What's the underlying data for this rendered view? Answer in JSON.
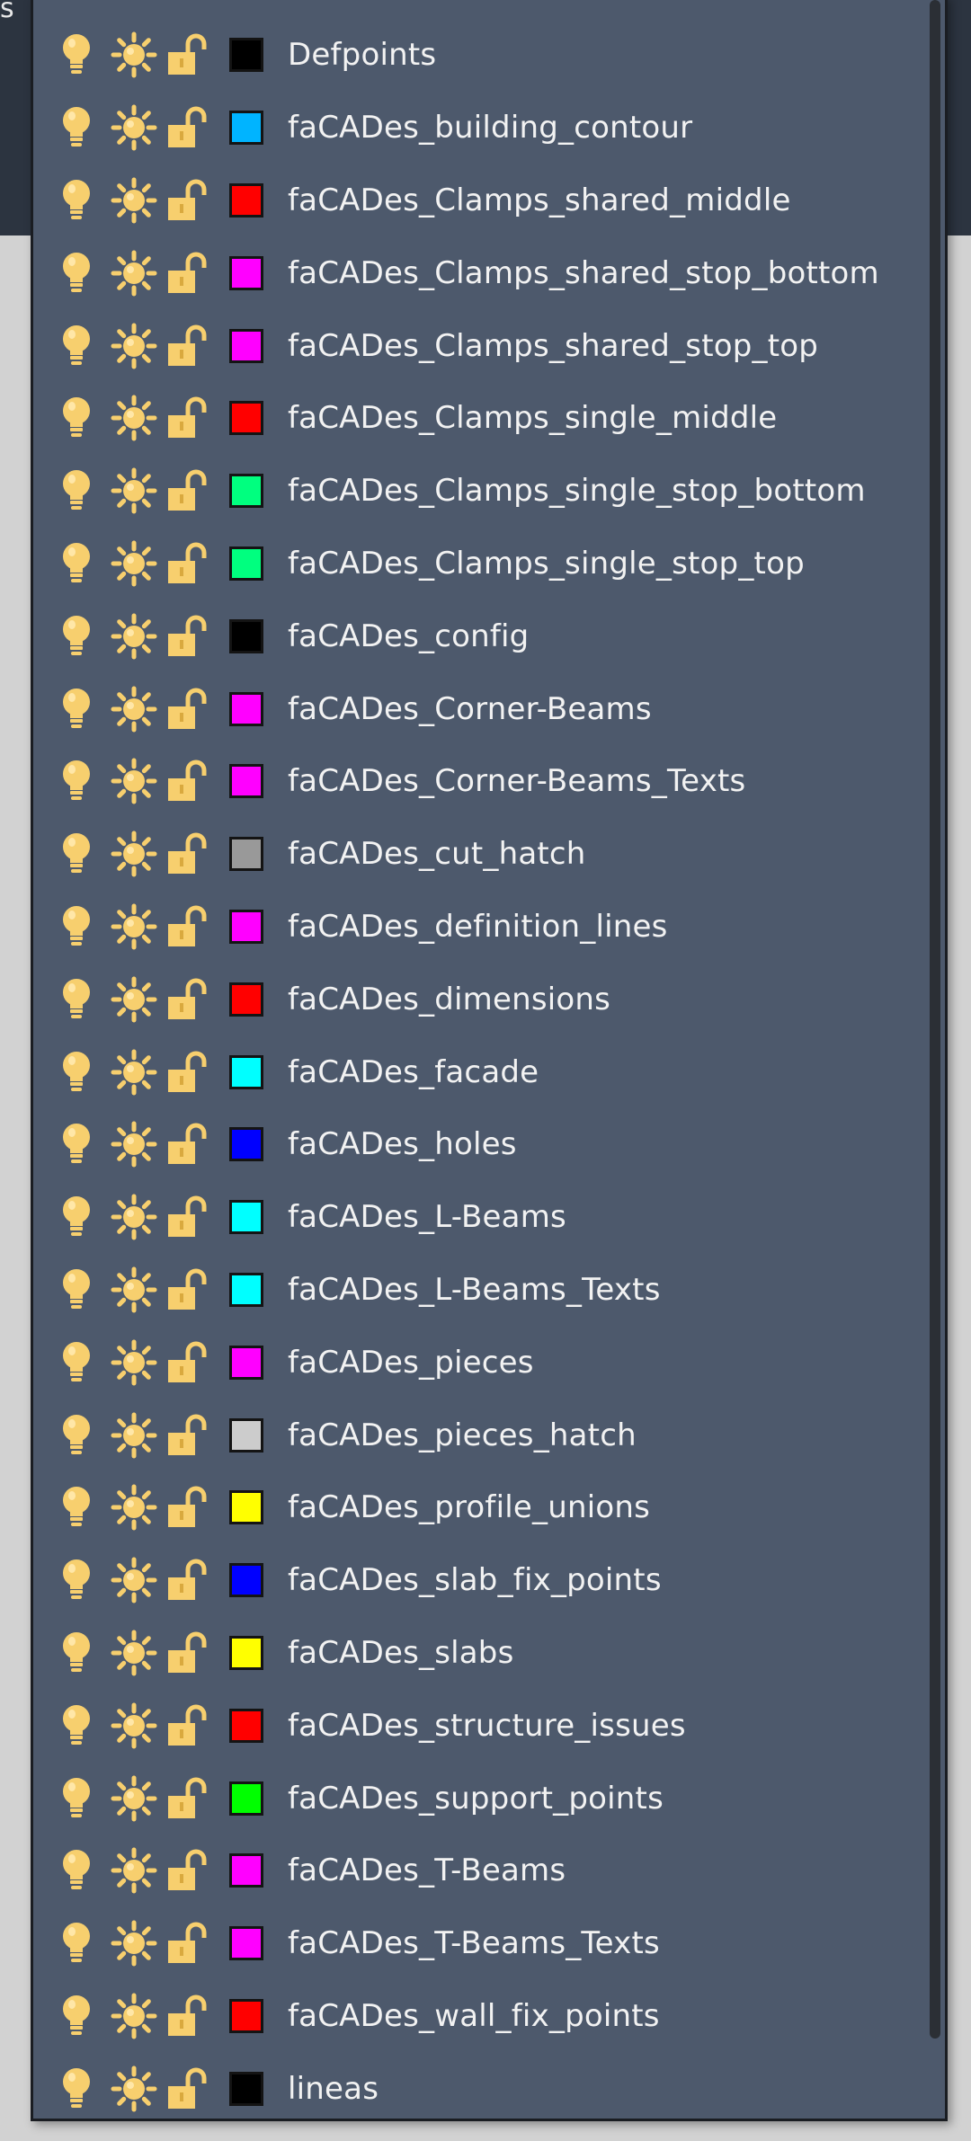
{
  "background": {
    "top_left_text": "s"
  },
  "colors": {
    "panel_bg": "#4d596c",
    "text": "#f2f2f2",
    "icon_yellow": "#f7cf6e",
    "page_bg": "#d2d2d2"
  },
  "layers": [
    {
      "name": "Defpoints",
      "color": "#000000"
    },
    {
      "name": "faCADes_building_contour",
      "color": "#00b4ff"
    },
    {
      "name": "faCADes_Clamps_shared_middle",
      "color": "#ff0000"
    },
    {
      "name": "faCADes_Clamps_shared_stop_bottom",
      "color": "#ff00ff"
    },
    {
      "name": "faCADes_Clamps_shared_stop_top",
      "color": "#ff00ff"
    },
    {
      "name": "faCADes_Clamps_single_middle",
      "color": "#ff0000"
    },
    {
      "name": "faCADes_Clamps_single_stop_bottom",
      "color": "#00ff7f"
    },
    {
      "name": "faCADes_Clamps_single_stop_top",
      "color": "#00ff7f"
    },
    {
      "name": "faCADes_config",
      "color": "#000000"
    },
    {
      "name": "faCADes_Corner-Beams",
      "color": "#ff00ff"
    },
    {
      "name": "faCADes_Corner-Beams_Texts",
      "color": "#ff00ff"
    },
    {
      "name": "faCADes_cut_hatch",
      "color": "#999999"
    },
    {
      "name": "faCADes_definition_lines",
      "color": "#ff00ff"
    },
    {
      "name": "faCADes_dimensions",
      "color": "#ff0000"
    },
    {
      "name": "faCADes_facade",
      "color": "#00ffff"
    },
    {
      "name": "faCADes_holes",
      "color": "#0000ff"
    },
    {
      "name": "faCADes_L-Beams",
      "color": "#00ffff"
    },
    {
      "name": "faCADes_L-Beams_Texts",
      "color": "#00ffff"
    },
    {
      "name": "faCADes_pieces",
      "color": "#ff00ff"
    },
    {
      "name": "faCADes_pieces_hatch",
      "color": "#cccccc"
    },
    {
      "name": "faCADes_profile_unions",
      "color": "#ffff00"
    },
    {
      "name": "faCADes_slab_fix_points",
      "color": "#0000ff"
    },
    {
      "name": "faCADes_slabs",
      "color": "#ffff00"
    },
    {
      "name": "faCADes_structure_issues",
      "color": "#ff0000"
    },
    {
      "name": "faCADes_support_points",
      "color": "#00ff00"
    },
    {
      "name": "faCADes_T-Beams",
      "color": "#ff00ff"
    },
    {
      "name": "faCADes_T-Beams_Texts",
      "color": "#ff00ff"
    },
    {
      "name": "faCADes_wall_fix_points",
      "color": "#ff0000"
    },
    {
      "name": "lineas",
      "color": "#000000"
    }
  ],
  "row_icons": [
    "lightbulb-icon",
    "sun-freeze-icon",
    "unlocked-padlock-icon"
  ]
}
